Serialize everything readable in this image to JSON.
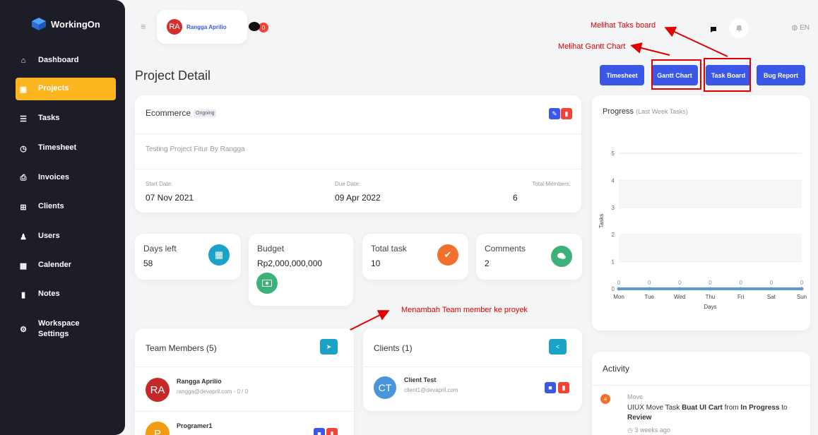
{
  "brand": {
    "name": "WorkingOn"
  },
  "sidebar": {
    "items": [
      {
        "label": "Dashboard",
        "icon": "home-icon",
        "glyph": "⌂"
      },
      {
        "label": "Projects",
        "icon": "briefcase-icon",
        "glyph": "▣",
        "active": true
      },
      {
        "label": "Tasks",
        "icon": "list-icon",
        "glyph": "☰"
      },
      {
        "label": "Timesheet",
        "icon": "clock-icon",
        "glyph": "◷"
      },
      {
        "label": "Invoices",
        "icon": "printer-icon",
        "glyph": "⎙"
      },
      {
        "label": "Clients",
        "icon": "sitemap-icon",
        "glyph": "⊞"
      },
      {
        "label": "Users",
        "icon": "user-icon",
        "glyph": "♟"
      },
      {
        "label": "Calender",
        "icon": "calendar-icon",
        "glyph": "▦"
      },
      {
        "label": "Notes",
        "icon": "clipboard-icon",
        "glyph": "▮"
      },
      {
        "label": "Workspace\nSettings",
        "icon": "gears-icon",
        "glyph": "⚙"
      }
    ]
  },
  "topbar": {
    "user_initials": "RA",
    "user_name": "Rangga Aprilio",
    "chat_count": "0",
    "lang": "EN"
  },
  "page": {
    "title": "Project Detail"
  },
  "actions": {
    "timesheet": "Timesheet",
    "gantt": "Gantt Chart",
    "task_board": "Task Board",
    "bug_report": "Bug Report"
  },
  "annotations": {
    "task_board": "Melihat Taks board",
    "gantt": "Melihat Gantt Chart",
    "team": "Menambah Team member ke proyek"
  },
  "project": {
    "name": "Ecommerce",
    "status": "Ongoing",
    "description": "Testing Project Fitur By Rangga",
    "start_label": "Start Date:",
    "start_date": "07 Nov 2021",
    "due_label": "Due Date:",
    "due_date": "09 Apr 2022",
    "members_label": "Total Members:",
    "members_count": "6"
  },
  "stats": {
    "days_left_label": "Days left",
    "days_left_value": "58",
    "budget_label": "Budget",
    "budget_value": "Rp2,000,000,000",
    "total_task_label": "Total task",
    "total_task_value": "10",
    "comments_label": "Comments",
    "comments_value": "2"
  },
  "team": {
    "title": "Team Members (5)",
    "members": [
      {
        "initials": "RA",
        "name": "Rangga Aprilio",
        "sub": "rangga@devapril.com - 0 / 0"
      },
      {
        "initials": "P",
        "name": "Programer1",
        "sub": ""
      }
    ]
  },
  "clients": {
    "title": "Clients (1)",
    "items": [
      {
        "initials": "CT",
        "name": "Client Test",
        "email": "client1@devapril.com"
      }
    ]
  },
  "progress": {
    "title": "Progress",
    "subtitle": "(Last Week Tasks)"
  },
  "chart_data": {
    "type": "line",
    "categories": [
      "Mon",
      "Tue",
      "Wed",
      "Thu",
      "Fri",
      "Sat",
      "Sun"
    ],
    "series": [
      {
        "values": [
          0,
          0,
          0,
          0,
          0,
          0,
          0
        ]
      }
    ],
    "xlabel": "Days",
    "ylabel": "Tasks",
    "ylim": [
      0,
      5
    ],
    "yticks": [
      0,
      1,
      2,
      3,
      4,
      5
    ],
    "grid": true,
    "line_color": "#5b9bd5"
  },
  "activity": {
    "title": "Activity",
    "items": [
      {
        "type": "Move",
        "prefix": "UIUX Move Task ",
        "task": "Buat UI Cart",
        "middle": " from ",
        "from": "In Progress",
        "to_word": " to ",
        "to": "Review",
        "time": "3 weeks ago"
      }
    ]
  },
  "colors": {
    "primary": "#3a57e8",
    "accent": "#fdb520",
    "danger": "#f44336",
    "info": "#1aa2c9",
    "success": "#3cb17a",
    "orange": "#f36f2c"
  }
}
